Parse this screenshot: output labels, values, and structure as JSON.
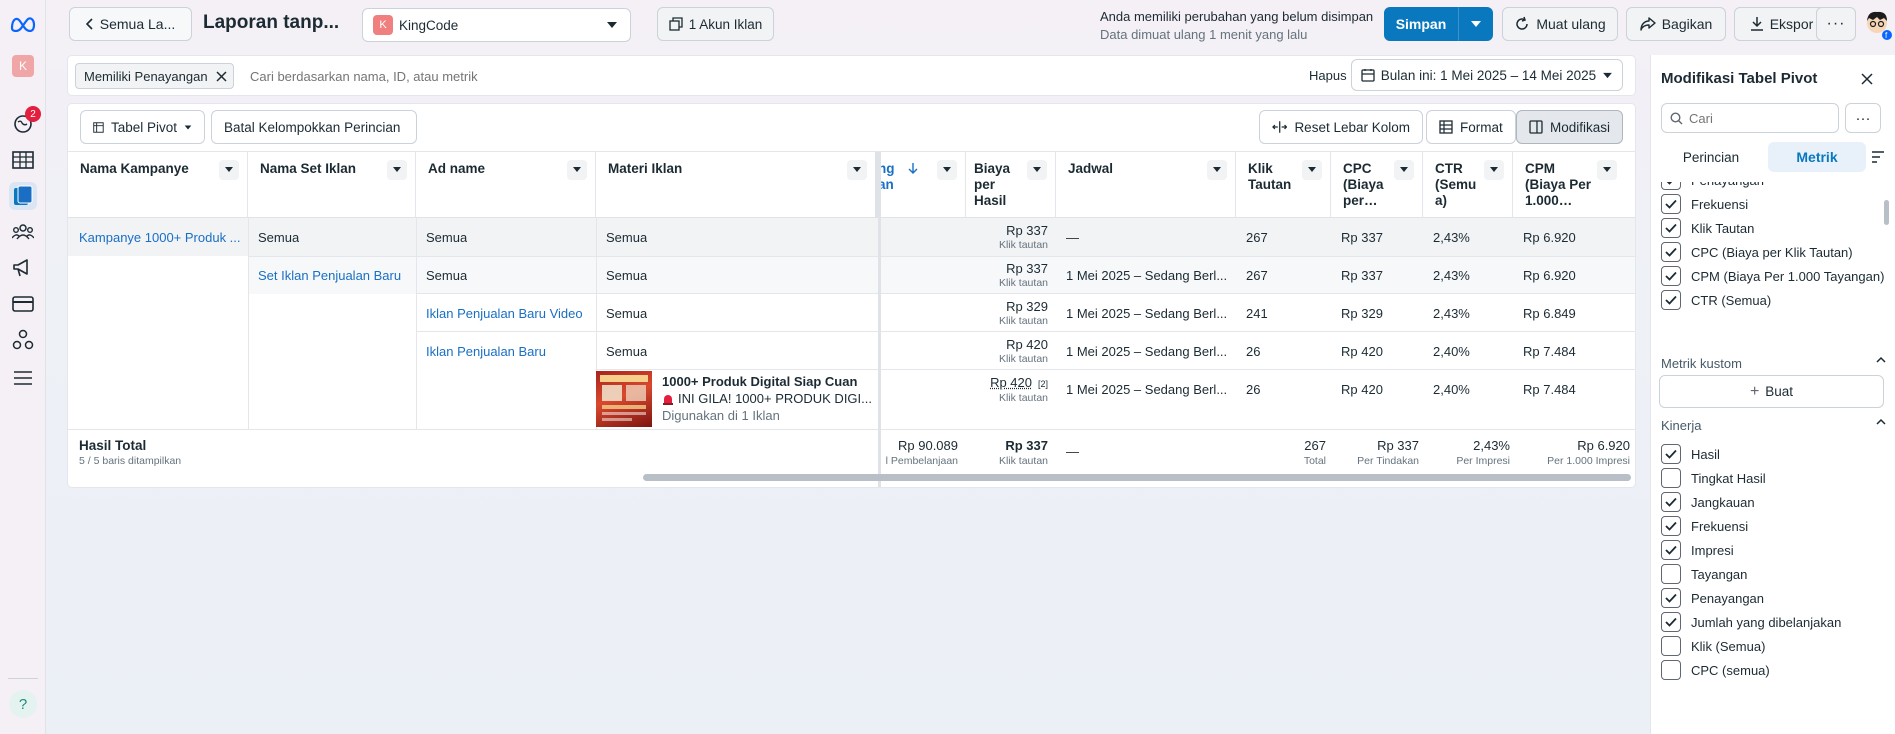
{
  "nav": {
    "avatar_letter": "K",
    "notification_count": "2"
  },
  "topbar": {
    "back_label": "Semua La...",
    "report_title": "Laporan tanp...",
    "account_letter": "K",
    "account_name": "KingCode",
    "ad_accounts_label": "1 Akun Iklan",
    "unsaved_title": "Anda memiliki perubahan yang belum disimpan",
    "reload_info": "Data dimuat ulang 1 menit yang lalu",
    "save_label": "Simpan",
    "reload_label": "Muat ulang",
    "share_label": "Bagikan",
    "export_label": "Ekspor"
  },
  "filter": {
    "chip_label": "Memiliki Penayangan",
    "search_placeholder": "Cari berdasarkan nama, ID, atau metrik",
    "clear_label": "Hapus",
    "date_range": "Bulan ini: 1 Mei 2025 – 14 Mei 2025"
  },
  "toolbar": {
    "pivot_label": "Tabel Pivot",
    "ungroup_label": "Batal Kelompokkan Perincian",
    "reset_width_label": "Reset Lebar Kolom",
    "format_label": "Format",
    "modify_label": "Modifikasi"
  },
  "table": {
    "headers": {
      "campaign": "Nama Kampanye",
      "adset": "Nama Set Iklan",
      "ad": "Ad name",
      "creative": "Materi Iklan",
      "spent_a": "ng",
      "spent_b": "an",
      "cpr_1": "Biaya",
      "cpr_2": "per",
      "cpr_3": "Hasil",
      "schedule": "Jadwal",
      "clicks_1": "Klik",
      "clicks_2": "Tautan",
      "cpc_1": "CPC",
      "cpc_2": "(Biaya",
      "cpc_3": "per…",
      "ctr_1": "CTR",
      "ctr_2": "(Semu",
      "ctr_3": "a)",
      "cpm_1": "CPM",
      "cpm_2": "(Biaya Per",
      "cpm_3": "1.000…"
    },
    "rows": [
      {
        "campaign": "Kampanye 1000+ Produk ...",
        "adset": "Semua",
        "ad": "Semua",
        "creative": "Semua",
        "cpr": "Rp 337",
        "cpr_sub": "Klik tautan",
        "schedule": "—",
        "clicks": "267",
        "cpc": "Rp 337",
        "ctr": "2,43%",
        "cpm": "Rp 6.920"
      },
      {
        "campaign": "",
        "adset": "Set Iklan Penjualan Baru",
        "ad": "Semua",
        "creative": "Semua",
        "cpr": "Rp 337",
        "cpr_sub": "Klik tautan",
        "schedule": "1 Mei 2025 – Sedang Berl...",
        "clicks": "267",
        "cpc": "Rp 337",
        "ctr": "2,43%",
        "cpm": "Rp 6.920"
      },
      {
        "campaign": "",
        "adset": "",
        "ad": "Iklan Penjualan Baru Video",
        "creative": "Semua",
        "cpr": "Rp 329",
        "cpr_sub": "Klik tautan",
        "schedule": "1 Mei 2025 – Sedang Berl...",
        "clicks": "241",
        "cpc": "Rp 329",
        "ctr": "2,43%",
        "cpm": "Rp 6.849"
      },
      {
        "campaign": "",
        "adset": "",
        "ad": "Iklan Penjualan Baru",
        "creative": "Semua",
        "cpr": "Rp 420",
        "cpr_sub": "Klik tautan",
        "schedule": "1 Mei 2025 – Sedang Berl...",
        "clicks": "26",
        "cpc": "Rp 420",
        "ctr": "2,40%",
        "cpm": "Rp 7.484"
      }
    ],
    "creative_row": {
      "title": "1000+ Produk Digital Siap Cuan",
      "body": "INI GILA! 1000+ PRODUK DIGI...",
      "usage": "Digunakan di 1 Iklan",
      "cpr": "Rp 420",
      "cpr_note": "[2]",
      "cpr_sub": "Klik tautan",
      "schedule": "1 Mei 2025 – Sedang Berl...",
      "clicks": "26",
      "cpc": "Rp 420",
      "ctr": "2,40%",
      "cpm": "Rp 7.484"
    },
    "totals": {
      "label": "Hasil Total",
      "rows_shown": "5 / 5 baris ditampilkan",
      "spent": "Rp 90.089",
      "spent_sub": "l Pembelanjaan",
      "cpr": "Rp 337",
      "cpr_sub": "Klik tautan",
      "schedule": "—",
      "clicks": "267",
      "clicks_sub": "Total",
      "cpc": "Rp 337",
      "cpc_sub": "Per Tindakan",
      "ctr": "2,43%",
      "ctr_sub": "Per Impresi",
      "cpm": "Rp 6.920",
      "cpm_sub": "Per 1.000 Impresi"
    }
  },
  "panel": {
    "title": "Modifikasi Tabel Pivot",
    "search_placeholder": "Cari",
    "tab_breakdown": "Perincian",
    "tab_metrics": "Metrik",
    "top_metrics": [
      {
        "label": "Penayangan",
        "checked": true
      },
      {
        "label": "Frekuensi",
        "checked": true
      },
      {
        "label": "Klik Tautan",
        "checked": true
      },
      {
        "label": "CPC (Biaya per Klik Tautan)",
        "checked": true
      },
      {
        "label": "CPM (Biaya Per 1.000 Tayangan)",
        "checked": true
      },
      {
        "label": "CTR (Semua)",
        "checked": true
      }
    ],
    "custom_section": "Metrik kustom",
    "create_label": "Buat",
    "performance_section": "Kinerja",
    "performance_metrics": [
      {
        "label": "Hasil",
        "checked": true
      },
      {
        "label": "Tingkat Hasil",
        "checked": false
      },
      {
        "label": "Jangkauan",
        "checked": true
      },
      {
        "label": "Frekuensi",
        "checked": true
      },
      {
        "label": "Impresi",
        "checked": true
      },
      {
        "label": "Tayangan",
        "checked": false
      },
      {
        "label": "Penayangan",
        "checked": true
      },
      {
        "label": "Jumlah yang dibelanjakan",
        "checked": true
      },
      {
        "label": "Klik (Semua)",
        "checked": false
      },
      {
        "label": "CPC (semua)",
        "checked": false
      }
    ]
  },
  "colors": {
    "primary": "#0a78be",
    "link": "#1a6fc4",
    "badge": "#e41e3f"
  }
}
